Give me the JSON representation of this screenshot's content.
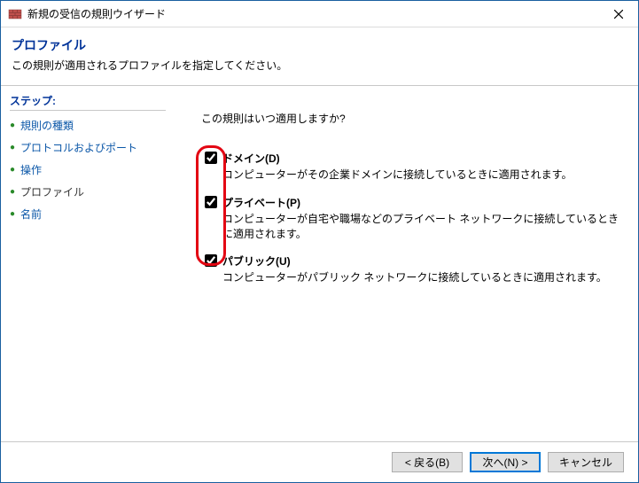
{
  "titlebar": {
    "title": "新規の受信の規則ウイザード"
  },
  "header": {
    "title": "プロファイル",
    "description": "この規則が適用されるプロファイルを指定してください。"
  },
  "sidebar": {
    "steps_label": "ステップ:",
    "items": [
      {
        "label": "規則の種類"
      },
      {
        "label": "プロトコルおよびポート"
      },
      {
        "label": "操作"
      },
      {
        "label": "プロファイル"
      },
      {
        "label": "名前"
      }
    ],
    "current_index": 3
  },
  "content": {
    "question": "この規則はいつ適用しますか?",
    "options": [
      {
        "label": "ドメイン(D)",
        "description": "コンピューターがその企業ドメインに接続しているときに適用されます。",
        "checked": true
      },
      {
        "label": "プライベート(P)",
        "description": "コンピューターが自宅や職場などのプライベート ネットワークに接続しているときに適用されます。",
        "checked": true
      },
      {
        "label": "パブリック(U)",
        "description": "コンピューターがパブリック ネットワークに接続しているときに適用されます。",
        "checked": true
      }
    ]
  },
  "footer": {
    "back": "< 戻る(B)",
    "next": "次へ(N) >",
    "cancel": "キャンセル"
  }
}
